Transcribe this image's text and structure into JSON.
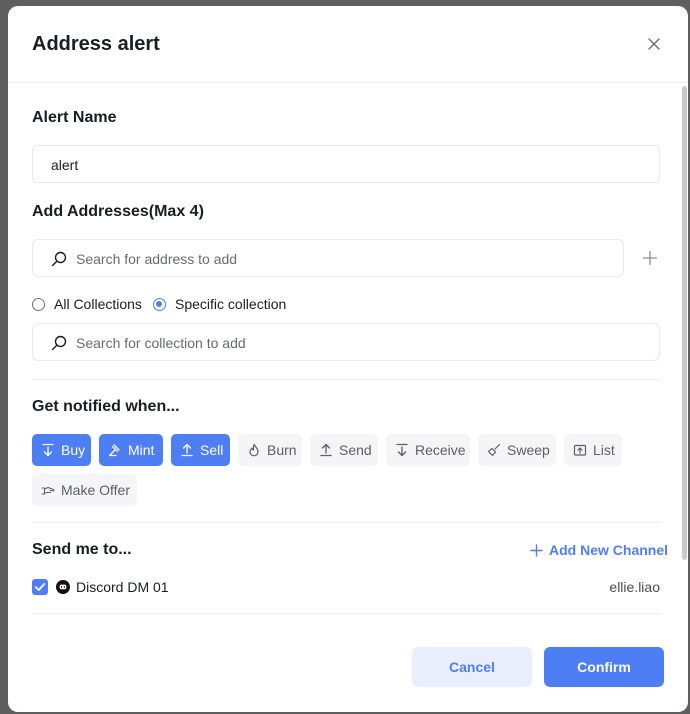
{
  "modal": {
    "title": "Address alert"
  },
  "alert_name": {
    "label": "Alert Name",
    "value": "alert"
  },
  "addresses": {
    "label": "Add Addresses(Max 4)",
    "placeholder": "Search for address to add"
  },
  "collection_scope": {
    "options": [
      "All Collections",
      "Specific collection"
    ],
    "selected": "Specific collection",
    "placeholder": "Search for collection to add"
  },
  "notify": {
    "label": "Get notified when...",
    "events": [
      {
        "label": "Buy",
        "active": true,
        "icon": "arrow-down-icon"
      },
      {
        "label": "Mint",
        "active": true,
        "icon": "hammer-icon"
      },
      {
        "label": "Sell",
        "active": true,
        "icon": "arrow-up-icon"
      },
      {
        "label": "Burn",
        "active": false,
        "icon": "flame-icon"
      },
      {
        "label": "Send",
        "active": false,
        "icon": "upload-arrow-icon"
      },
      {
        "label": "Receive",
        "active": false,
        "icon": "download-arrow-icon"
      },
      {
        "label": "Sweep",
        "active": false,
        "icon": "broom-icon"
      },
      {
        "label": "List",
        "active": false,
        "icon": "list-box-icon"
      },
      {
        "label": "Make Offer",
        "active": false,
        "icon": "hand-offer-icon"
      }
    ]
  },
  "send_to": {
    "label": "Send me to...",
    "add_channel_label": "Add New Channel",
    "channels": [
      {
        "name": "Discord DM 01",
        "user": "ellie.liao",
        "checked": true,
        "icon": "discord-icon"
      }
    ]
  },
  "footer": {
    "cancel_label": "Cancel",
    "confirm_label": "Confirm"
  },
  "colors": {
    "accent": "#4e7ef4",
    "accent_light": "#e9eefd",
    "backdrop": "#5f5f5f"
  }
}
